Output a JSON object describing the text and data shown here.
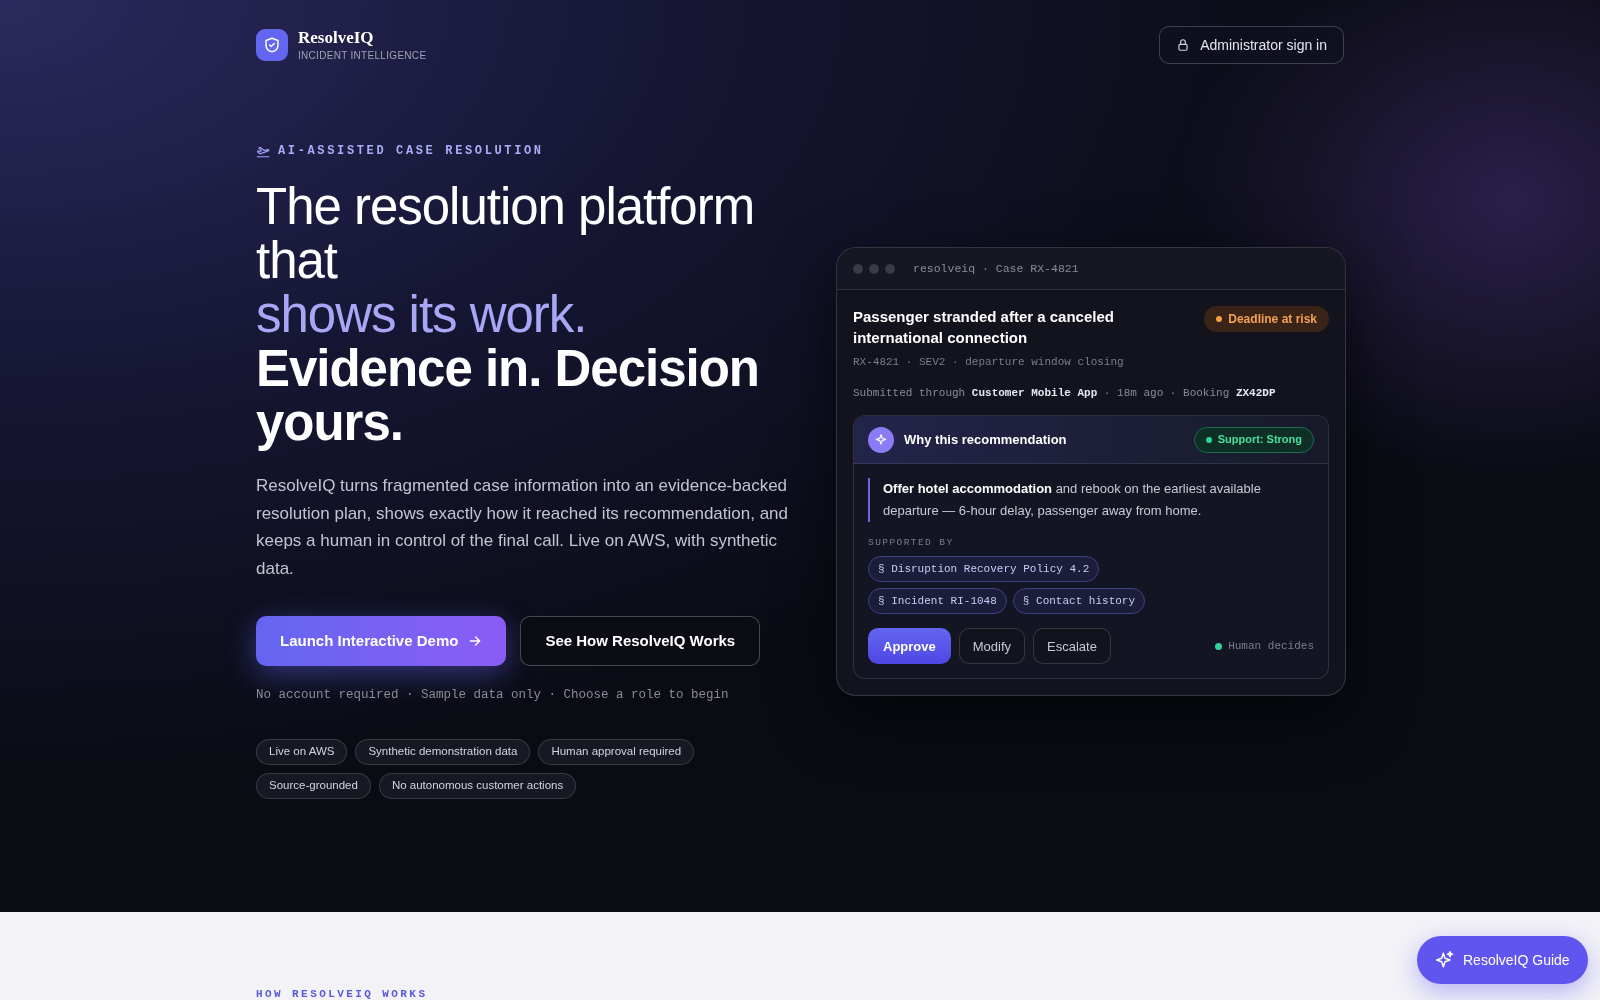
{
  "brand": {
    "name": "ResolveIQ",
    "tagline": "INCIDENT INTELLIGENCE"
  },
  "header_button": "Administrator sign in",
  "eyebrow": "AI-ASSISTED CASE RESOLUTION",
  "headline": [
    {
      "text": "The resolution platform that",
      "kind": "light"
    },
    {
      "text": "shows its work.",
      "kind": "accent"
    },
    {
      "text": "Evidence in. Decision yours.",
      "kind": "bold"
    }
  ],
  "intro": "ResolveIQ turns fragmented case information into an evidence-backed resolution plan, shows exactly how it reached its recommendation, and keeps a human in control of the final call. Live on AWS, with synthetic data.",
  "buttons": [
    {
      "label": "Launch Interactive Demo",
      "kind": "primary"
    },
    {
      "label": "See How ResolveIQ Works",
      "kind": "secondary"
    }
  ],
  "note": "No account required · Sample data only · Choose a role to begin",
  "tags": [
    "Live on AWS",
    "Synthetic demonstration data",
    "Human approval required",
    "Source-grounded",
    "No autonomous customer actions"
  ],
  "case_card": {
    "window_title": "resolveiq · Case RX-4821",
    "title": "Passenger stranded after a canceled international connection",
    "status": {
      "label": "Deadline at risk",
      "color": "#f59e42"
    },
    "meta": "RX-4821 · SEV2 · departure window closing",
    "submitted": "Submitted through **Customer Mobile App** · 18m ago · Booking **ZX42DP**",
    "recommendation": {
      "heading": "Why this recommendation",
      "support": {
        "label": "Support: Strong",
        "color": "#34d399"
      },
      "text": "**Offer hotel accommodation** and rebook on the earliest available departure — 6-hour delay, passenger away from home.",
      "supported_by_label": "SUPPORTED BY",
      "sources": [
        "§ Disruption Recovery Policy 4.2",
        "§ Incident RI-1048",
        "§ Contact history"
      ],
      "actions": [
        {
          "label": "Approve",
          "kind": "primary"
        },
        {
          "label": "Modify",
          "kind": "secondary"
        },
        {
          "label": "Escalate",
          "kind": "secondary"
        }
      ],
      "decider": {
        "label": "Human decides",
        "color": "#34d399"
      }
    }
  },
  "section_label": "HOW RESOLVEIQ WORKS",
  "guide_button": "ResolveIQ Guide"
}
